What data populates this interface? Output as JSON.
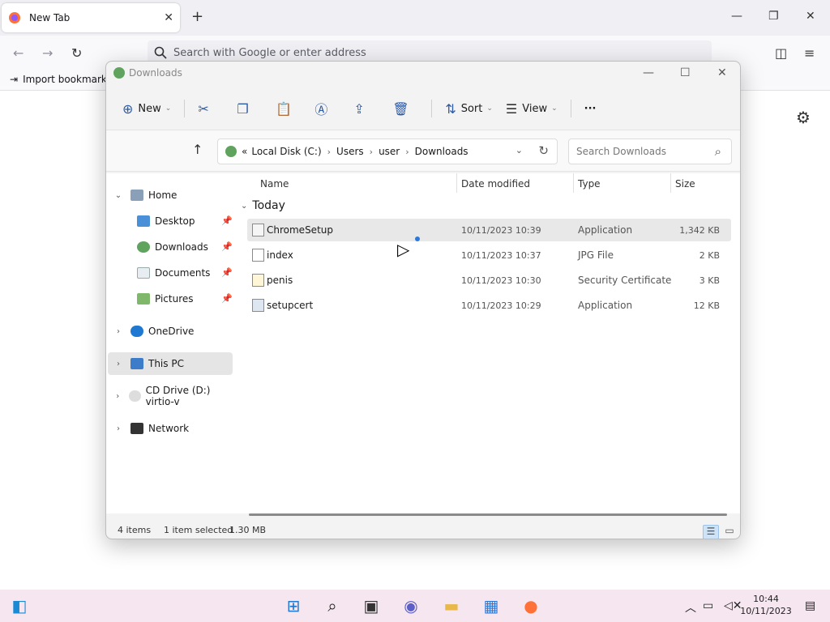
{
  "browser": {
    "tab_title": "New Tab",
    "tab_close": "✕",
    "new_tab": "+",
    "url_placeholder": "Search with Google or enter address",
    "bookmark_import": "Import bookmarks"
  },
  "explorer": {
    "window_title": "Downloads",
    "toolbar": {
      "new_label": "New",
      "sort_label": "Sort",
      "view_label": "View",
      "more": "···"
    },
    "address": {
      "prefix": "«",
      "crumbs": [
        "Local Disk (C:)",
        "Users",
        "user",
        "Downloads"
      ],
      "search_placeholder": "Search Downloads"
    },
    "nav": {
      "home": "Home",
      "desktop": "Desktop",
      "downloads": "Downloads",
      "documents": "Documents",
      "pictures": "Pictures",
      "onedrive": "OneDrive",
      "thispc": "This PC",
      "cddrive": "CD Drive (D:) virtio-v",
      "network": "Network"
    },
    "columns": {
      "name": "Name",
      "date": "Date modified",
      "type": "Type",
      "size": "Size"
    },
    "group": "Today",
    "files": [
      {
        "name": "ChromeSetup",
        "date": "10/11/2023 10:39",
        "type": "Application",
        "size": "1,342 KB"
      },
      {
        "name": "index",
        "date": "10/11/2023 10:37",
        "type": "JPG File",
        "size": "2 KB"
      },
      {
        "name": "penis",
        "date": "10/11/2023 10:30",
        "type": "Security Certificate",
        "size": "3 KB"
      },
      {
        "name": "setupcert",
        "date": "10/11/2023 10:29",
        "type": "Application",
        "size": "12 KB"
      }
    ],
    "status": {
      "items": "4 items",
      "selected": "1 item selected",
      "selsize": "1.30 MB"
    }
  },
  "taskbar": {
    "time": "10:44",
    "date": "10/11/2023"
  },
  "colors": {
    "accent": "#2b79d8",
    "selection": "#e8e8e8",
    "taskbar": "#f5e6ef"
  }
}
